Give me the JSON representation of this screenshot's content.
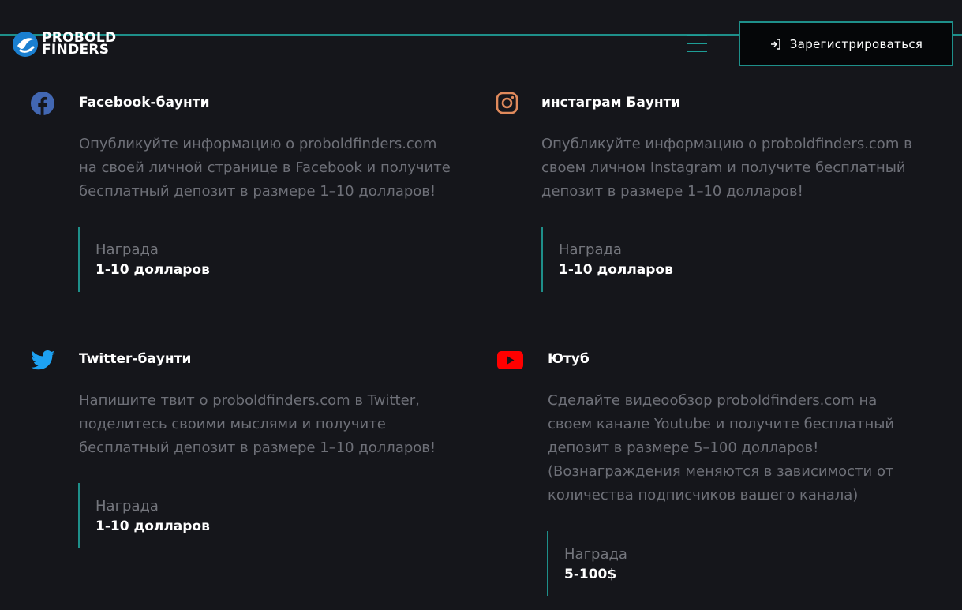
{
  "header": {
    "logo_line1": "PROBOLD",
    "logo_line2": "FINDERS",
    "register_label": "Зарегистрироваться",
    "accent_color": "#1e8f8a"
  },
  "cards": [
    {
      "icon": "facebook-icon",
      "title": "Facebook-баунти",
      "lines": [
        "Опубликуйте информацию о proboldfinders.com",
        "на своей личной странице в Facebook и получите",
        "бесплатный депозит в размере 1–10 долларов!"
      ],
      "reward_label": "Награда",
      "reward_value": "1-10 долларов"
    },
    {
      "icon": "instagram-icon",
      "title": "инстаграм Баунти",
      "lines": [
        "Опубликуйте информацию о proboldfinders.com в",
        "своем личном Instagram и получите бесплатный",
        "депозит в размере 1–10 долларов!"
      ],
      "reward_label": "Награда",
      "reward_value": "1-10 долларов"
    },
    {
      "icon": "twitter-icon",
      "title": "Twitter-баунти",
      "lines": [
        "Напишите твит о proboldfinders.com в Twitter,",
        "поделитесь своими мыслями и получите",
        "бесплатный депозит в размере 1–10 долларов!"
      ],
      "reward_label": "Награда",
      "reward_value": "1-10 долларов"
    },
    {
      "icon": "youtube-icon",
      "title": "Ютуб",
      "lines": [
        "Сделайте видеообзор proboldfinders.com на",
        "своем канале Youtube и получите бесплатный",
        "депозит в размере 5–100 долларов!",
        "(Вознаграждения меняются в зависимости от",
        "количества подписчиков вашего канала)"
      ],
      "reward_label": "Награда",
      "reward_value": "5-100$"
    }
  ],
  "colors": {
    "background": "#15161b",
    "facebook": "#4267b2",
    "instagram": "#e08a5c",
    "twitter": "#1da1f2",
    "youtube": "#ff0000"
  }
}
